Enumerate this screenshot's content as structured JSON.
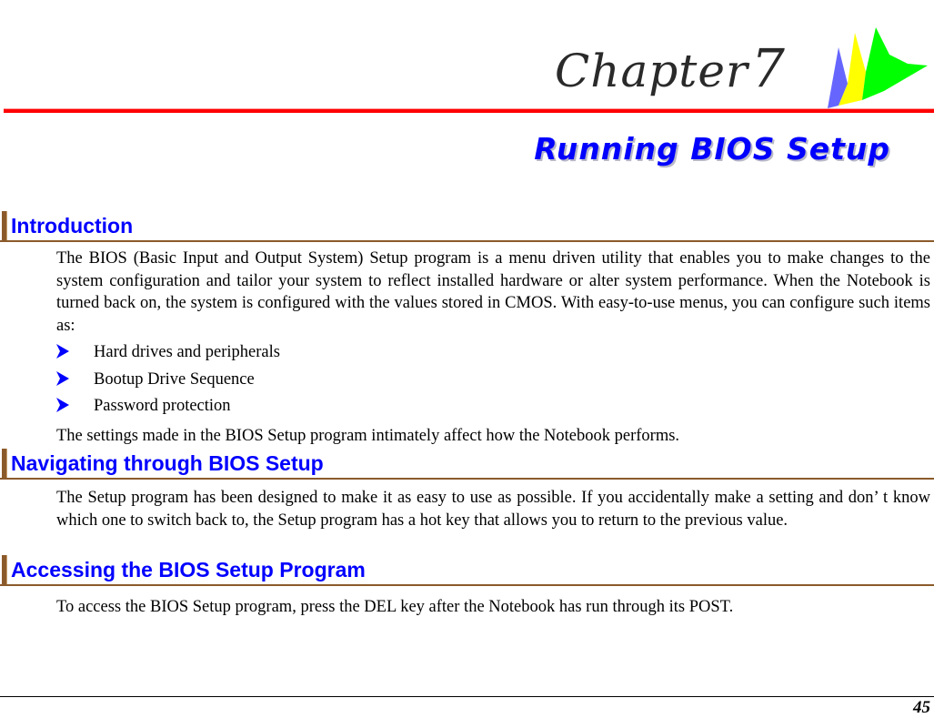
{
  "header": {
    "chapter_word": "Chapter",
    "chapter_number": "7",
    "logo_icon": "chapter-logo-icon",
    "colors": {
      "rule": "#ff0000",
      "logo_blue": "#6666ff",
      "logo_yellow": "#ffff00",
      "logo_green": "#00ff00"
    }
  },
  "page_title": "Running BIOS Setup",
  "sections": [
    {
      "title": "Introduction",
      "paragraphs": [
        "The BIOS (Basic Input and Output System) Setup program is a menu driven utility that enables you to make changes to the system configuration and tailor your system to reflect installed hardware or alter system performance. When the Notebook is turned back on, the system is configured with the values stored in CMOS. With easy-to-use menus, you can configure such items as:"
      ],
      "bullets": [
        "Hard drives and peripherals",
        "Bootup Drive Sequence",
        "Password protection"
      ],
      "closing": "The settings made in the BIOS Setup program intimately affect how the Notebook performs."
    },
    {
      "title": "Navigating through BIOS Setup",
      "paragraphs": [
        "The Setup program has been designed to make it as easy to use as possible.  If you accidentally make a setting and don’ t know which one to switch back to, the Setup program has a hot key that allows you to return to the previous value."
      ]
    },
    {
      "title": "Accessing the BIOS Setup Program",
      "paragraphs": [
        "To access the BIOS Setup program, press the DEL key after the Notebook has run through its POST."
      ]
    }
  ],
  "bullet_icon": "arrowhead-bullet-icon",
  "accent_colors": {
    "heading": "#0000ff",
    "section_rule": "#8b5a2b"
  },
  "footer": {
    "page_number": "45"
  }
}
